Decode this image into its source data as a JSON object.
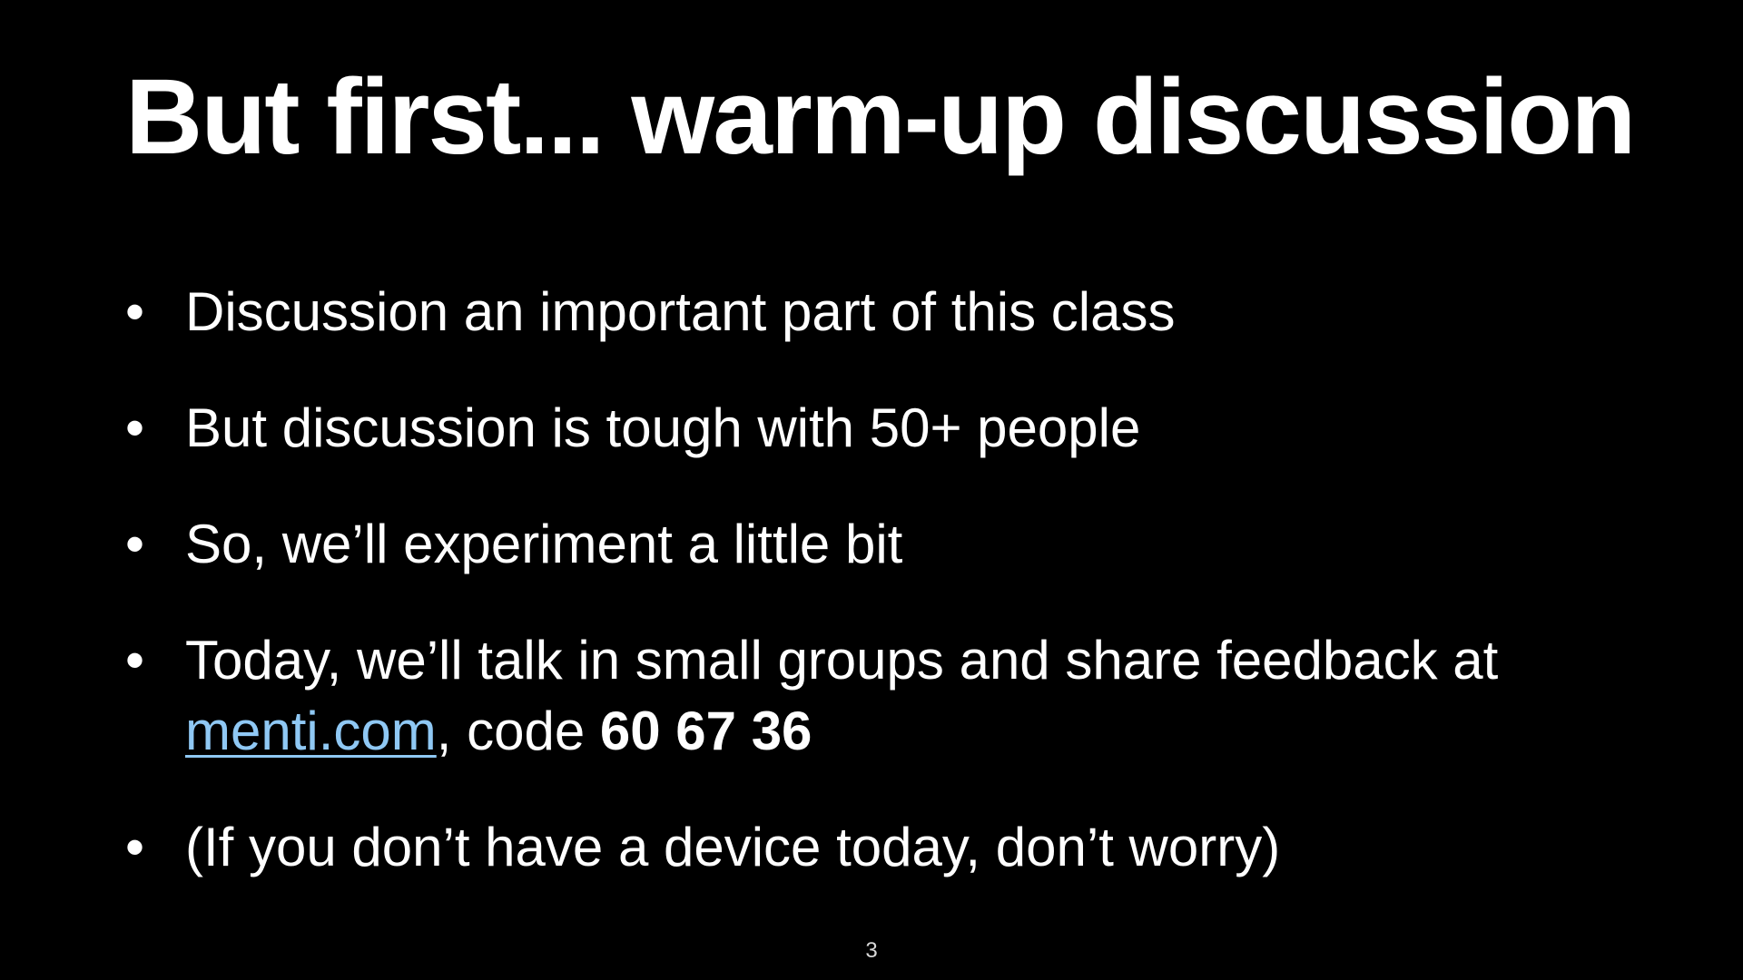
{
  "slide": {
    "title": "But first... warm-up discussion",
    "bullet_symbol": "•",
    "bullets": [
      "Discussion an important part of this class",
      "But discussion is tough with 50+ people",
      "So, we’ll experiment a little bit",
      {
        "line1": "Today, we’ll talk in small groups and share feedback at",
        "link": "menti.com",
        "middle": ", code ",
        "code": "60 67 36"
      },
      "(If you don’t have a device today, don’t worry)"
    ],
    "page_number": "3"
  },
  "colors": {
    "background": "#000000",
    "text": "#ffffff",
    "link": "#8fc8f4"
  }
}
